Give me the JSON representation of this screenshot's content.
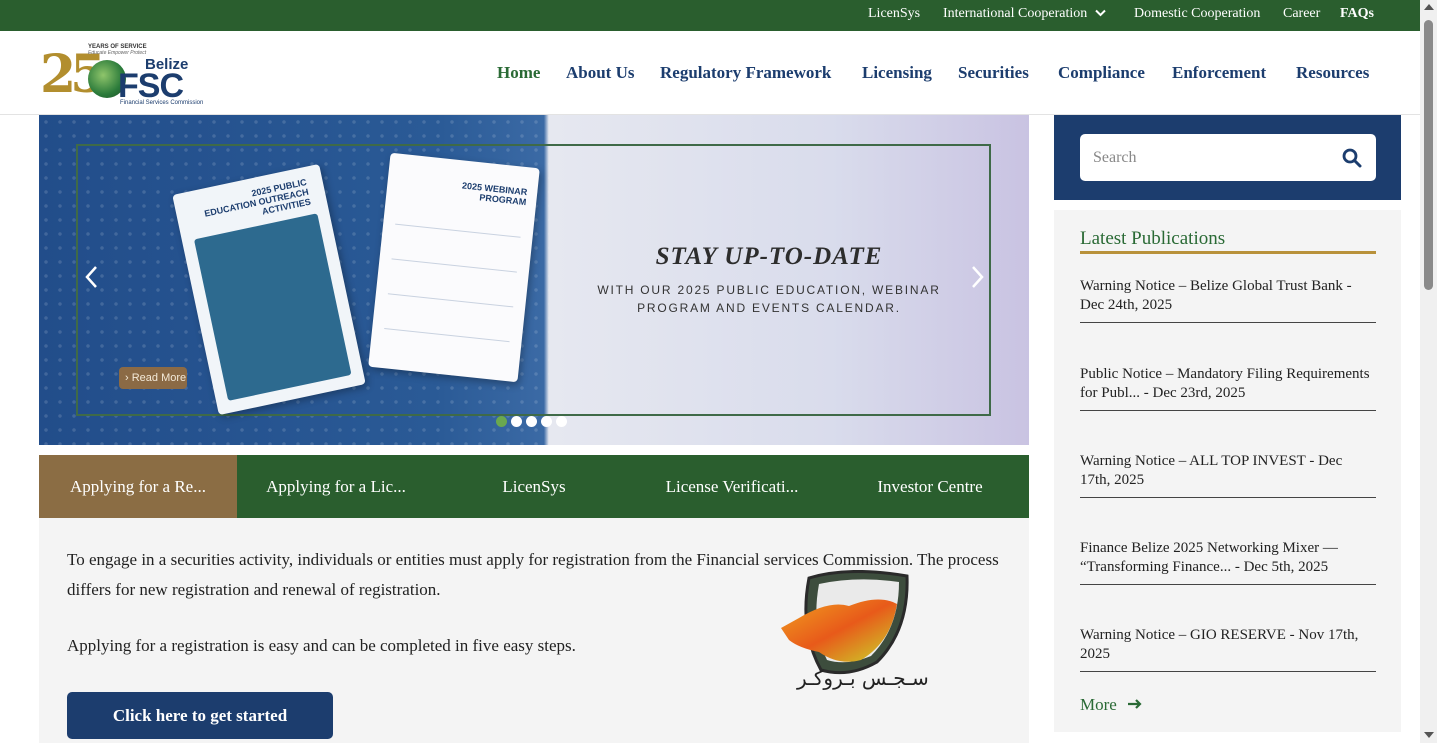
{
  "topbar": {
    "links": [
      {
        "label": "LicenSys"
      },
      {
        "label": "International Cooperation",
        "icon": "chevron-down-icon"
      },
      {
        "label": "Domestic Cooperation"
      },
      {
        "label": "Career"
      },
      {
        "label": "FAQs"
      }
    ]
  },
  "logo": {
    "anniversary": "25",
    "years_text": "YEARS OF SERVICE",
    "tagline": "Educate Empower Protect",
    "country": "Belize",
    "acronym": "FSC",
    "full_name": "Financial Services Commission"
  },
  "nav": {
    "items": [
      "Home",
      "About Us",
      "Regulatory Framework",
      "Licensing",
      "Securities",
      "Compliance",
      "Enforcement",
      "Resources"
    ],
    "active": "Home"
  },
  "hero": {
    "flyer1_title": "2025 PUBLIC EDUCATION OUTREACH ACTIVITIES",
    "flyer2_title": "2025 WEBINAR PROGRAM",
    "read_more": "Read More",
    "headline": "STAY UP-TO-DATE",
    "subline": "WITH OUR 2025 PUBLIC EDUCATION, WEBINAR PROGRAM AND EVENTS CALENDAR.",
    "prev_icon": "chevron-left-icon",
    "next_icon": "chevron-right-icon",
    "slide_count": 5,
    "active_slide": 1
  },
  "tabs": {
    "items": [
      "Applying for a Re...",
      "Applying for a Lic...",
      "LicenSys",
      "License Verificati...",
      "Investor Centre"
    ],
    "active_index": 0
  },
  "panel": {
    "paragraph1": "To engage in a securities activity, individuals or entities must apply for registration from the Financial services Commission. The process differs for new registration and renewal of registration.",
    "paragraph2": "Applying for a registration is easy and can be completed in five easy steps.",
    "button": "Click here to get started",
    "watermark_text": "سـجـس بـروكـر"
  },
  "sidebar": {
    "search_placeholder": "Search",
    "search_icon": "search-icon",
    "publications_title": "Latest Publications",
    "publications": [
      "Warning Notice – Belize Global Trust Bank - Dec 24th, 2025",
      "Public Notice – Mandatory Filing Requirements for Publ... - Dec 23rd, 2025",
      "Warning Notice – ALL TOP INVEST - Dec 17th, 2025",
      "Finance Belize 2025 Networking Mixer — “Transforming Finance... - Dec 5th, 2025",
      "Warning Notice – GIO RESERVE - Nov 17th, 2025"
    ],
    "more_label": "More",
    "more_icon": "arrow-right-icon"
  },
  "colors": {
    "green": "#2a5e2e",
    "navy": "#1c3d6e",
    "gold": "#b8913a",
    "tab_active": "#8b6d44"
  }
}
